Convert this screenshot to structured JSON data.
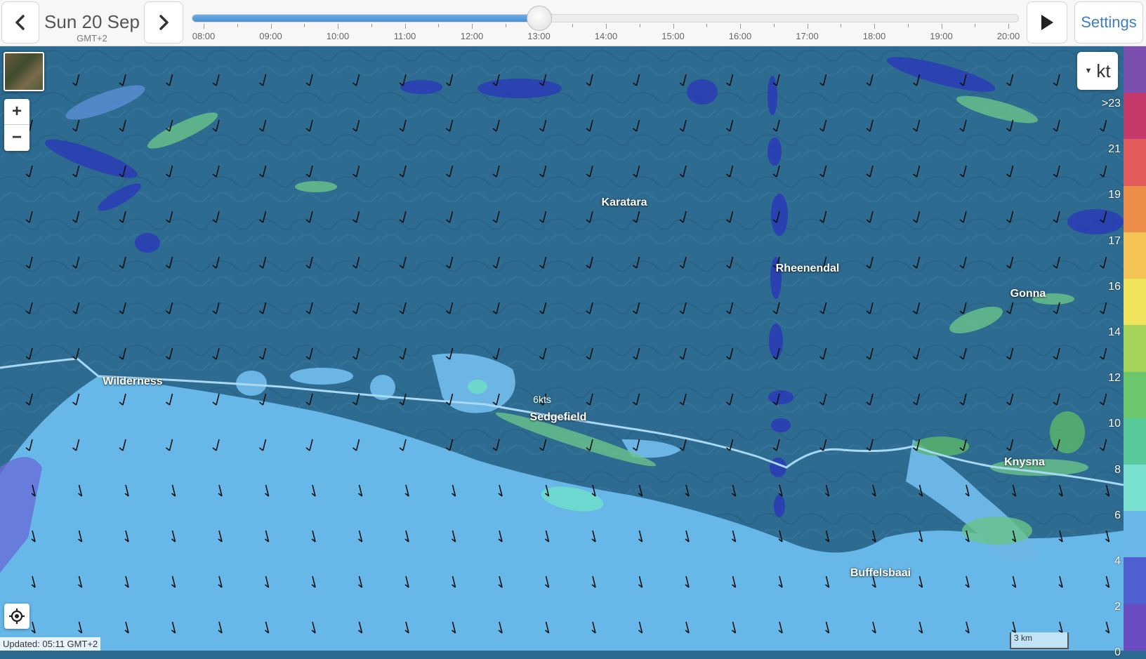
{
  "header": {
    "date": "Sun 20 Sep",
    "timezone": "GMT+2",
    "settings_label": "Settings",
    "timeline": {
      "labels": [
        "08:00",
        "09:00",
        "10:00",
        "11:00",
        "12:00",
        "13:00",
        "14:00",
        "15:00",
        "16:00",
        "17:00",
        "18:00",
        "19:00",
        "20:00"
      ],
      "selected_time": "13:00",
      "progress": 0.417
    },
    "icons": {
      "prev": "chevron-left-icon",
      "next": "chevron-right-icon",
      "play": "play-icon"
    }
  },
  "map": {
    "places": [
      {
        "name": "Wilderness"
      },
      {
        "name": "Sedgefield"
      },
      {
        "name": "Karatara"
      },
      {
        "name": "Rheenendal"
      },
      {
        "name": "Gonna"
      },
      {
        "name": "Knysna"
      },
      {
        "name": "Buffelsbaai"
      }
    ],
    "wind_readout": "6kts",
    "updated": "Updated: 05:11 GMT+2",
    "scale_label": "3 km"
  },
  "controls": {
    "zoom_in": "+",
    "zoom_out": "−",
    "unit": "kt"
  },
  "legend": {
    "labels": [
      ">23",
      "21",
      "19",
      "17",
      "16",
      "14",
      "12",
      "10",
      "8",
      "6",
      "4",
      "2",
      "0"
    ],
    "colors": [
      "#7b4fb0",
      "#c43a6a",
      "#e25b5b",
      "#ee8c4a",
      "#f3c356",
      "#eee35a",
      "#a6d45a",
      "#6cc76c",
      "#58c99a",
      "#7ae0d0",
      "#6ab8ea",
      "#5060d0",
      "#6a4cc0"
    ]
  }
}
